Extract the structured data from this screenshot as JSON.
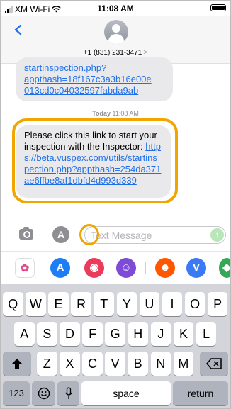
{
  "status": {
    "carrier": "XM Wi-Fi",
    "time": "11:08 AM"
  },
  "header": {
    "contact": "+1 (831) 231-3471",
    "chevron": ">"
  },
  "messages": {
    "m1": {
      "line1": "startinspection.php?",
      "line2": "appthash=18f167c3a3b16e00e",
      "line3": "013cd0c04032597fabda9ab"
    },
    "timestamp_day": "Today",
    "timestamp_time": "11:08 AM",
    "m2": {
      "text": "Please click this link to start your inspection with the Inspector: ",
      "link": "https://beta.vuspex.com/utils/startinspection.php?appthash=254da371ae6ffbe8af1dbfd4d993d339"
    }
  },
  "compose": {
    "placeholder": "Text Message"
  },
  "keyboard": {
    "row1": [
      "Q",
      "W",
      "E",
      "R",
      "T",
      "Y",
      "U",
      "I",
      "O",
      "P"
    ],
    "row2": [
      "A",
      "S",
      "D",
      "F",
      "G",
      "H",
      "J",
      "K",
      "L"
    ],
    "row3": [
      "Z",
      "X",
      "C",
      "V",
      "B",
      "N",
      "M"
    ],
    "numbers_key": "123",
    "space_key": "space",
    "return_key": "return"
  },
  "colors": {
    "highlight": "#f0a500",
    "link": "#1f6feb",
    "bubble": "#e9e9eb"
  }
}
